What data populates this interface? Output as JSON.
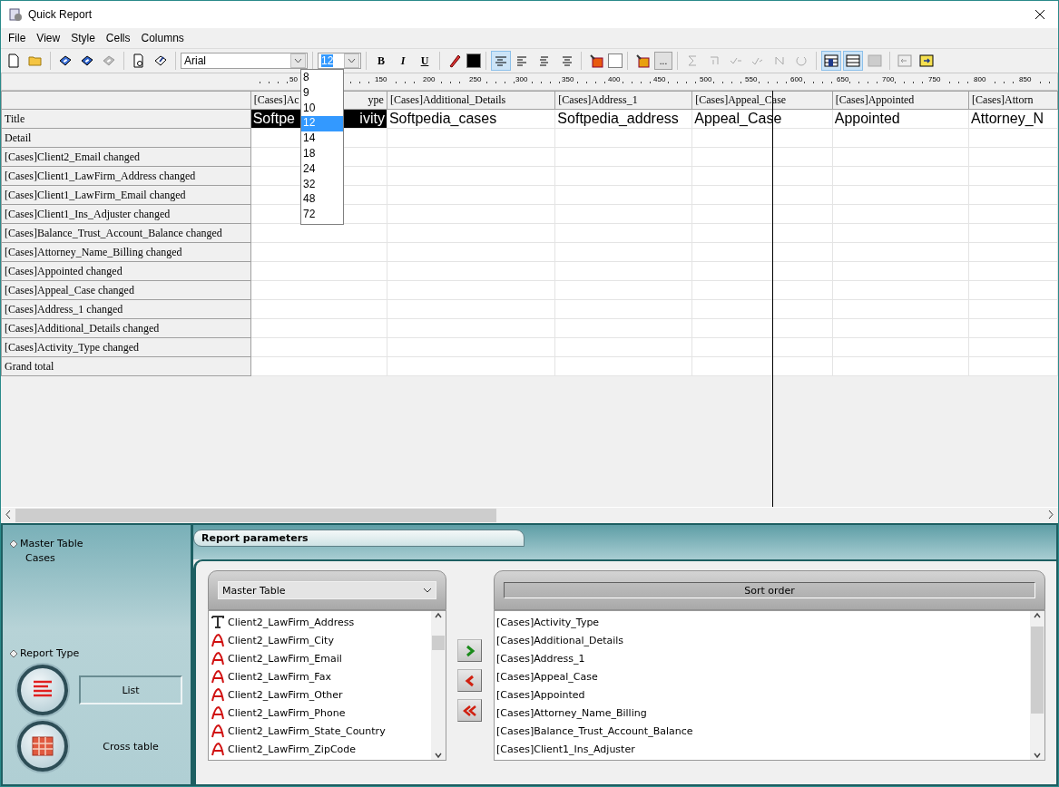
{
  "window": {
    "title": "Quick Report"
  },
  "menu": [
    "File",
    "View",
    "Style",
    "Cells",
    "Columns"
  ],
  "toolbar": {
    "font": "Arial",
    "font_size": "12",
    "format_buttons": [
      "B",
      "I",
      "U"
    ],
    "align_buttons": [
      {
        "selected": true
      },
      {
        "selected": false
      },
      {
        "selected": false
      },
      {
        "selected": false
      }
    ],
    "more_button": "...",
    "view_buttons": [
      {
        "selected": true
      },
      {
        "selected": true
      },
      {
        "selected": false
      }
    ]
  },
  "font_size_dropdown": [
    {
      "label": "8",
      "selected": false
    },
    {
      "label": "9",
      "selected": false
    },
    {
      "label": "10",
      "selected": false
    },
    {
      "label": "12",
      "selected": true
    },
    {
      "label": "14",
      "selected": false
    },
    {
      "label": "18",
      "selected": false
    },
    {
      "label": "24",
      "selected": false
    },
    {
      "label": "32",
      "selected": false
    },
    {
      "label": "48",
      "selected": false
    },
    {
      "label": "72",
      "selected": false
    }
  ],
  "ruler": [
    "50",
    "150",
    "200",
    "250",
    "300",
    "350",
    "400",
    "450",
    "500",
    "550",
    "600",
    "650",
    "700",
    "750",
    "800",
    "850"
  ],
  "grid": {
    "columns": [
      {
        "header": [
          "[Cases]Ac",
          "ype"
        ]
      },
      {
        "header": [
          "[Cases]Additional_Details"
        ]
      },
      {
        "header": [
          "[Cases]Address_1"
        ]
      },
      {
        "header": [
          "[Cases]Appeal_Case"
        ]
      },
      {
        "header": [
          "[Cases]Appointed"
        ]
      },
      {
        "header": [
          "[Cases]Attorn"
        ]
      }
    ],
    "title_row": {
      "label": "Title",
      "cells": [
        {
          "parts": [
            "Softpe",
            "ivity"
          ],
          "selected": true
        },
        {
          "parts": [
            "Softpedia_cases"
          ],
          "selected": false
        },
        {
          "parts": [
            "Softpedia_address"
          ],
          "selected": false
        },
        {
          "parts": [
            "Appeal_Case"
          ],
          "selected": false
        },
        {
          "parts": [
            "Appointed"
          ],
          "selected": false
        },
        {
          "parts": [
            "Attorney_N"
          ],
          "selected": false
        }
      ]
    },
    "row_labels": [
      "Detail",
      "[Cases]Client2_Email changed",
      "[Cases]Client1_LawFirm_Address changed",
      "[Cases]Client1_LawFirm_Email changed",
      "[Cases]Client1_Ins_Adjuster changed",
      "[Cases]Balance_Trust_Account_Balance changed",
      "[Cases]Attorney_Name_Billing changed",
      "[Cases]Appointed changed",
      "[Cases]Appeal_Case changed",
      "[Cases]Address_1 changed",
      "[Cases]Additional_Details changed",
      "[Cases]Activity_Type changed",
      "Grand total"
    ]
  },
  "side_panel": {
    "master_table_label": "Master Table",
    "master_table_value": "Cases",
    "report_type_label": "Report Type",
    "report_types": [
      {
        "kind": "list",
        "label": "List",
        "selected": true
      },
      {
        "kind": "cross",
        "label": "Cross table",
        "selected": false
      }
    ]
  },
  "parameters": {
    "title": "Report parameters",
    "source_select": "Master Table",
    "fields": [
      {
        "kind": "text",
        "label": "Client2_LawFirm_Address"
      },
      {
        "kind": "string",
        "label": "Client2_LawFirm_City"
      },
      {
        "kind": "string",
        "label": "Client2_LawFirm_Email"
      },
      {
        "kind": "string",
        "label": "Client2_LawFirm_Fax"
      },
      {
        "kind": "string",
        "label": "Client2_LawFirm_Other"
      },
      {
        "kind": "string",
        "label": "Client2_LawFirm_Phone"
      },
      {
        "kind": "string",
        "label": "Client2_LawFirm_State_Country"
      },
      {
        "kind": "string",
        "label": "Client2_LawFirm_ZipCode"
      }
    ],
    "sort_title": "Sort order",
    "sort_fields": [
      "[Cases]Activity_Type",
      "[Cases]Additional_Details",
      "[Cases]Address_1",
      "[Cases]Appeal_Case",
      "[Cases]Appointed",
      "[Cases]Attorney_Name_Billing",
      "[Cases]Balance_Trust_Account_Balance",
      "[Cases]Client1_Ins_Adjuster"
    ]
  }
}
